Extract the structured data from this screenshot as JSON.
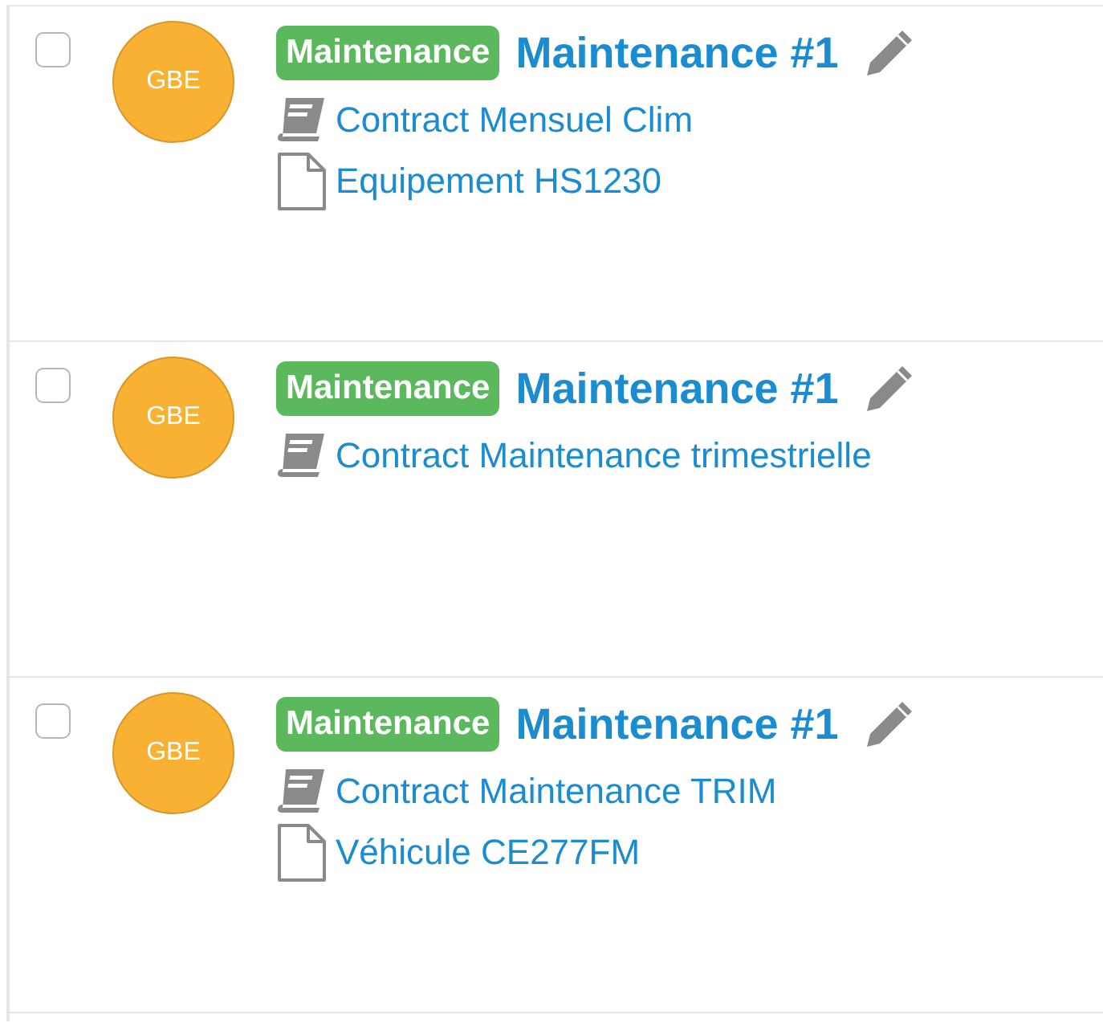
{
  "items": [
    {
      "checked": false,
      "avatar": "GBE",
      "badge": "Maintenance",
      "title": "Maintenance #1",
      "links": [
        {
          "kind": "contract",
          "text": "Contract Mensuel Clim"
        },
        {
          "kind": "document",
          "text": "Equipement HS1230"
        }
      ]
    },
    {
      "checked": false,
      "avatar": "GBE",
      "badge": "Maintenance",
      "title": "Maintenance #1",
      "links": [
        {
          "kind": "contract",
          "text": "Contract Maintenance trimestrielle"
        }
      ]
    },
    {
      "checked": false,
      "avatar": "GBE",
      "badge": "Maintenance",
      "title": "Maintenance #1",
      "links": [
        {
          "kind": "contract",
          "text": "Contract Maintenance TRIM"
        },
        {
          "kind": "document",
          "text": "Véhicule CE277FM"
        }
      ]
    }
  ]
}
